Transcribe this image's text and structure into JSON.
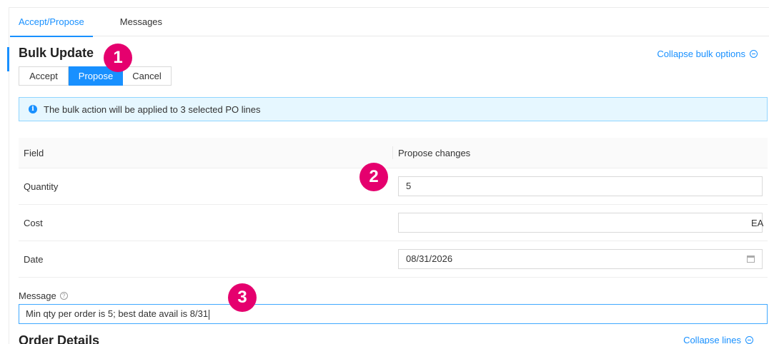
{
  "tabs": [
    {
      "label": "Accept/Propose",
      "active": true
    },
    {
      "label": "Messages",
      "active": false
    }
  ],
  "bulk": {
    "title": "Bulk Update",
    "collapse_label": "Collapse bulk options",
    "buttons": {
      "accept": "Accept",
      "propose": "Propose",
      "cancel": "Cancel"
    },
    "active_button": "Propose",
    "info": "The bulk action will be applied to 3 selected PO lines"
  },
  "table": {
    "headers": {
      "field": "Field",
      "propose": "Propose changes"
    },
    "rows": [
      {
        "field": "Quantity",
        "value": "5",
        "unit": ""
      },
      {
        "field": "Cost",
        "value": "",
        "unit": "EA"
      },
      {
        "field": "Date",
        "value": "08/31/2026",
        "unit": ""
      }
    ]
  },
  "message": {
    "label": "Message",
    "value": "Min qty per order is 5; best date avail is 8/31"
  },
  "order": {
    "title": "Order Details",
    "collapse_label": "Collapse lines"
  },
  "badges": [
    "1",
    "2",
    "3"
  ],
  "colors": {
    "accent": "#1890ff",
    "badge": "#e5006e",
    "info_bg": "#e6f7ff"
  },
  "icons": {
    "info": "info-circle-icon",
    "help": "question-circle-icon",
    "calendar": "calendar-icon",
    "collapse": "minus-circle-icon"
  }
}
